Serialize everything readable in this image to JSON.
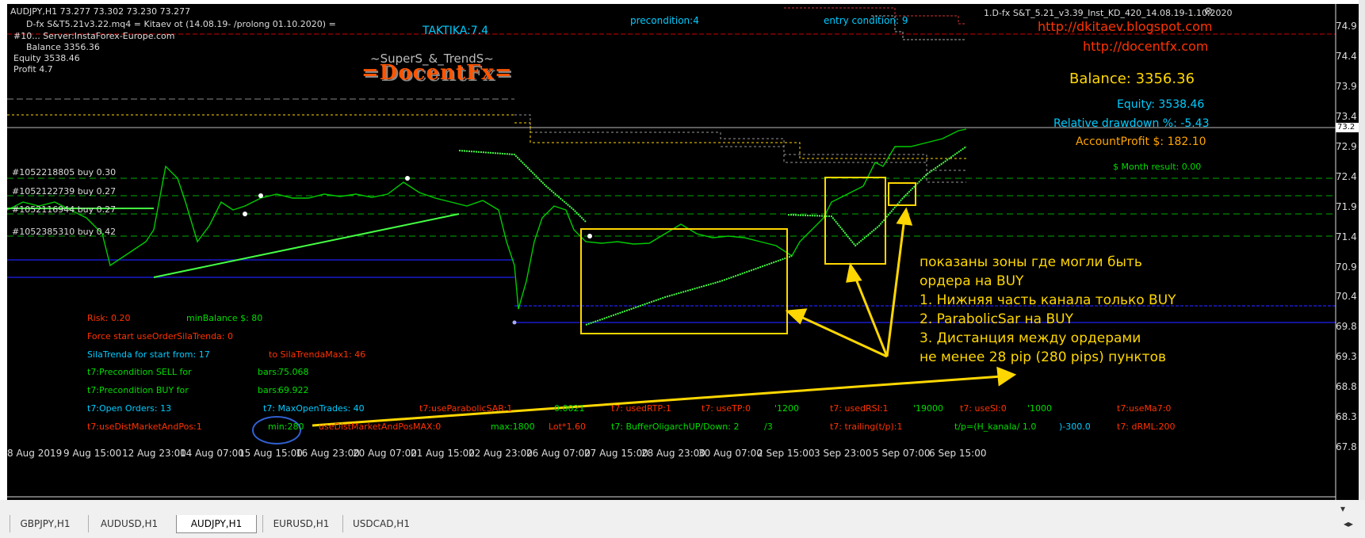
{
  "chart": {
    "symbol_line": "AUDJPY,H1  73.277 73.302 73.230 73.277",
    "ea_line": "D-fx S&T5.21v3.22.mq4 = Kitaev ot (14.08.19- /prolong 01.10.2020) =",
    "server_line": "#10... Server:InstaForex-Europe.com",
    "balance_small": "Balance  3356.36",
    "equity_small": "Equity  3538.46",
    "profit_small": "Profit  4.7",
    "taktika": "TAKTIKA:7.4",
    "precondition": "precondition:4",
    "entry_condition": "entry condition: 9",
    "indicator_name": "1.D-fx S&T_5.21_v3.39_Inst_KD_420_14.08.19-1.10.2020",
    "url1": "http://dkitaev.blogspot.com",
    "url2": "http://docentfx.com",
    "supers_trends": "~SuperS_&_TrendS~",
    "docentfx_logo": "=DocentFx=",
    "balance_big": "Balance: 3356.36",
    "equity_big": "Equity: 3538.46",
    "rel_drawdown": "Relative drawdown %: -5.43",
    "account_profit": "AccountProfit $: 182.10",
    "month_result": "$ Month result: 0.00",
    "price_marker": "73.2"
  },
  "orders": [
    "#1052218805 buy 0.30",
    "#1052122739 buy 0.27",
    "#1052116944 buy 0.27",
    "#1052385310 buy 0.42"
  ],
  "annotation": {
    "line1": "показаны зоны где могли быть",
    "line2": "ордера на BUY",
    "line3": "1. Нижняя часть канала только BUY",
    "line4": "2. ParabolicSar на BUY",
    "line5": "3. Дистанция между ордерами",
    "line6": "не менее 28 pip (280 pips) пунктов"
  },
  "panel": {
    "risk": "Risk: 0.20",
    "min_balance": "minBalance $: 80",
    "force_start": "Force start useOrderSilaTrenda: 0",
    "sila_start": "SilaTrenda for start from: 17",
    "sila_max": "to SilaTrendaMax1: 46",
    "precond_sell": "t7:Precondition  SELL  for",
    "bars_sell": "bars:",
    "sell_val": "75.068",
    "precond_buy": "t7:Precondition  BUY  for",
    "bars_buy": "bars:",
    "buy_val": "69.922",
    "open_orders": "t7:Open Orders: 13",
    "max_open": "t7: MaxOpenTrades: 40",
    "use_parabolic": "t7:useParabolicSAR:1",
    "param_0021": "0.0021",
    "used_rtp": "t7: usedRTP:1",
    "use_tp": "t7: useTP:0",
    "val_1200": "'1200",
    "used_rsi": "t7: usedRSI:1",
    "val_19000": "'19000",
    "use_sl": "t7: useSl:0",
    "val_1000": "'1000",
    "use_ma": "t7:useMa7:0",
    "use_dist": "t7:useDistMarketAndPos:1",
    "min_280": "min:280",
    "use_dist_max": "useDistMarketAndPosMAX:0",
    "max_1800": "max:1800",
    "lot": "Lot*1.60",
    "buffer_oligarch": "t7: BufferOligarchUP/Down: 2",
    "slash3": "/3",
    "trailing": "t7: trailing(t/p):1",
    "tp_kanala": "t/p=(H_kanala/ 1.0",
    "val_300": ")-300.0",
    "drml": "t7: dRML:200"
  },
  "price_scale": [
    "74.9",
    "74.4",
    "73.9",
    "73.4",
    "72.9",
    "72.4",
    "71.9",
    "71.4",
    "70.9",
    "70.4",
    "69.8",
    "69.3",
    "68.8",
    "68.3",
    "67.8"
  ],
  "time_axis": [
    "8 Aug 2019",
    "9 Aug 15:00",
    "12 Aug 23:00",
    "14 Aug 07:00",
    "15 Aug 15:00",
    "16 Aug 23:00",
    "20 Aug 07:00",
    "21 Aug 15:00",
    "22 Aug 23:00",
    "26 Aug 07:00",
    "27 Aug 15:00",
    "28 Aug 23:00",
    "30 Aug 07:00",
    "2 Sep 15:00",
    "3 Sep 23:00",
    "5 Sep 07:00",
    "6 Sep 15:00"
  ],
  "tabs": [
    "GBPJPY,H1",
    "AUDUSD,H1",
    "AUDJPY,H1",
    "EURUSD,H1",
    "USDCAD,H1"
  ],
  "active_tab": "AUDJPY,H1",
  "colors": {
    "chart_bg": "#000000",
    "candles": "#00cc00",
    "trend_line": "#44ff44",
    "grid_dash": "#00aa00",
    "yellow": "#ffd700",
    "orange": "#ff9900",
    "red_text": "#ff3300",
    "cyan_text": "#00ccff",
    "green_text": "#00dd00",
    "blue_line": "#1a1acc"
  }
}
